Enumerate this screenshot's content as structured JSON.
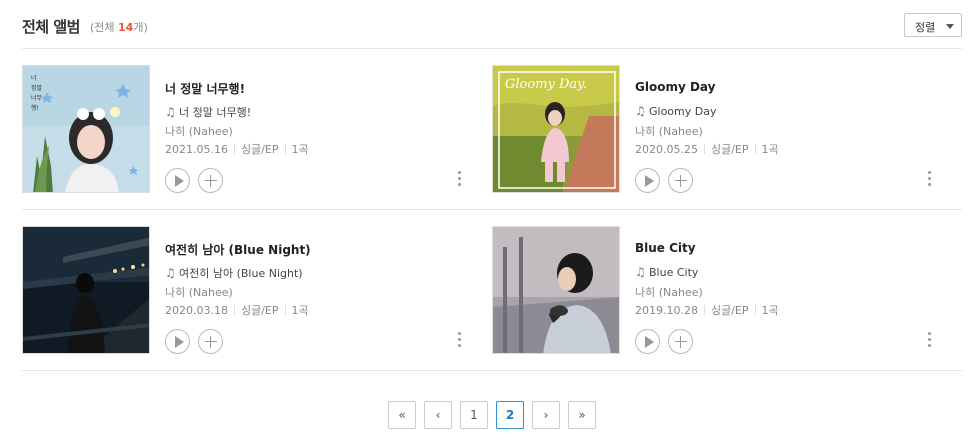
{
  "header": {
    "title": "전체 앨범",
    "count_prefix": "(전체 ",
    "count_value": "14",
    "count_suffix": "개)",
    "sort_label": "정렬"
  },
  "albums": [
    {
      "title": "너 정말 너무행!",
      "song": "너 정말 너무행!",
      "artist": "나히 (Nahee)",
      "date": "2021.05.16",
      "type": "싱글/EP",
      "tracks": "1곡"
    },
    {
      "title": "Gloomy Day",
      "song": "Gloomy Day",
      "artist": "나히 (Nahee)",
      "date": "2020.05.25",
      "type": "싱글/EP",
      "tracks": "1곡",
      "cover_text": "Gloomy Day."
    },
    {
      "title": "여전히 남아 (Blue Night)",
      "song": "여전히 남아 (Blue Night)",
      "artist": "나히 (Nahee)",
      "date": "2020.03.18",
      "type": "싱글/EP",
      "tracks": "1곡"
    },
    {
      "title": "Blue City",
      "song": "Blue City",
      "artist": "나히 (Nahee)",
      "date": "2019.10.28",
      "type": "싱글/EP",
      "tracks": "1곡"
    }
  ],
  "pagination": {
    "first": "«",
    "prev": "‹",
    "pages": [
      "1",
      "2"
    ],
    "current": "2",
    "next": "›",
    "last": "»"
  },
  "icons": {
    "note": "music-note-icon",
    "play": "play-icon",
    "add": "plus-icon",
    "more": "more-vertical-icon"
  },
  "colors": {
    "count_accent": "#e8573d",
    "current_page_border": "#2a8fd6"
  }
}
